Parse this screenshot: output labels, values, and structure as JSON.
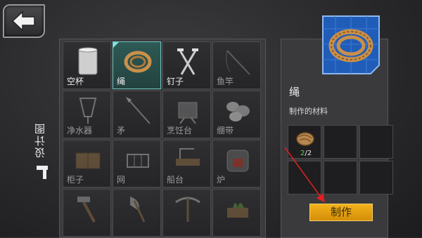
{
  "screen": "crafting-blueprints",
  "sidebar": {
    "tab_label": "设计图",
    "icon": "hammer-icon"
  },
  "grid": {
    "rows": [
      [
        {
          "name": "空杯",
          "icon": "cup-icon",
          "unlocked": true
        },
        {
          "name": "绳",
          "icon": "rope-icon",
          "unlocked": true,
          "selected": true
        },
        {
          "name": "钉子",
          "icon": "nails-icon",
          "unlocked": true
        },
        {
          "name": "鱼竿",
          "icon": "fishing-rod-icon",
          "unlocked": false
        }
      ],
      [
        {
          "name": "净水器",
          "icon": "water-purifier-icon",
          "unlocked": false
        },
        {
          "name": "矛",
          "icon": "spear-icon",
          "unlocked": false
        },
        {
          "name": "烹饪台",
          "icon": "cooking-station-icon",
          "unlocked": false
        },
        {
          "name": "绷带",
          "icon": "bandage-icon",
          "unlocked": false
        }
      ],
      [
        {
          "name": "柜子",
          "icon": "cabinet-icon",
          "unlocked": false
        },
        {
          "name": "网",
          "icon": "net-icon",
          "unlocked": false
        },
        {
          "name": "船台",
          "icon": "boat-station-icon",
          "unlocked": false
        },
        {
          "name": "炉",
          "icon": "furnace-icon",
          "unlocked": false
        }
      ],
      [
        {
          "name": "",
          "icon": "hammer-tool-icon",
          "unlocked": false
        },
        {
          "name": "",
          "icon": "axe-icon",
          "unlocked": false
        },
        {
          "name": "",
          "icon": "pickaxe-icon",
          "unlocked": false
        },
        {
          "name": "",
          "icon": "planter-icon",
          "unlocked": false
        }
      ]
    ]
  },
  "detail": {
    "title": "绳",
    "materials_label": "制作的材料",
    "material": {
      "icon": "fiber-bundle-icon",
      "have": "2",
      "sep": "/",
      "need": "2"
    },
    "craft_button": "制作"
  },
  "colors": {
    "accent_button": "#f2b21c",
    "have_count": "#5fd25f",
    "annotation_arrow": "#e02020",
    "selected_cell": "#2e5a56"
  }
}
